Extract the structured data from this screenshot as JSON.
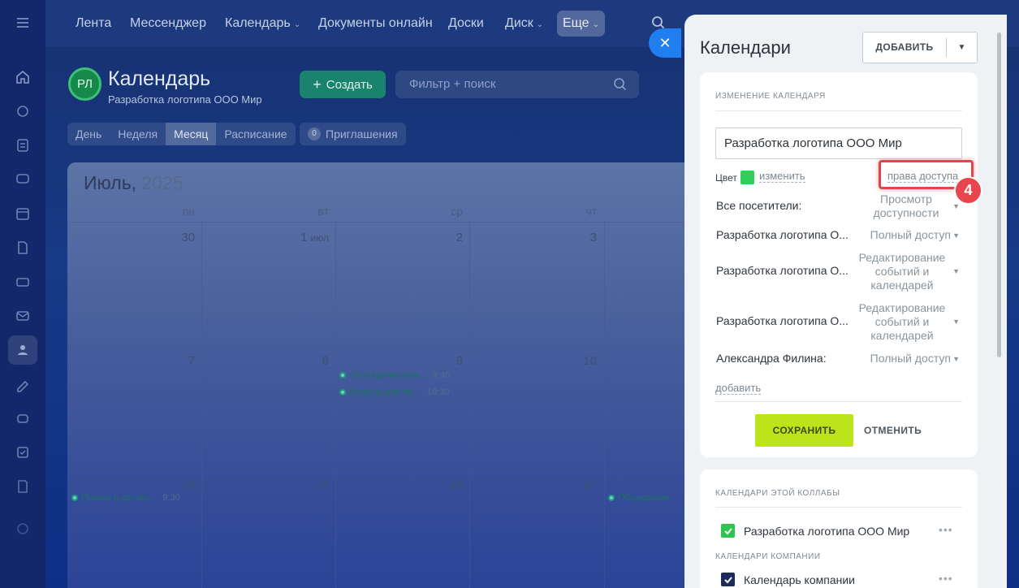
{
  "topnav": {
    "items": [
      "Лента",
      "Мессенджер",
      "Календарь",
      "Документы онлайн",
      "Доски",
      "Диск",
      "Еще"
    ]
  },
  "calendar": {
    "logo": "РЛ",
    "title": "Календарь",
    "subtitle": "Разработка логотипа ООО Мир",
    "create_label": "Создать",
    "filter_placeholder": "Фильтр + поиск",
    "views": [
      "День",
      "Неделя",
      "Месяц",
      "Расписание"
    ],
    "active_view": "Месяц",
    "invites_count": "0",
    "invites_label": "Приглашения",
    "month": "Июль,",
    "year": "2025",
    "weekdays": [
      "пн",
      "вт",
      "ср",
      "чт"
    ],
    "week1": [
      "30",
      "1",
      "2",
      "3"
    ],
    "week1_month": "июл",
    "week2": [
      "7",
      "8",
      "9",
      "10"
    ],
    "week3": [
      "14",
      "15",
      "16",
      "17"
    ],
    "events": [
      {
        "title": "Обсуждение мак...",
        "time": "9:40"
      },
      {
        "title": "Встреча для по...",
        "time": "10:30"
      },
      {
        "title": "Правки в догово...",
        "time": "9:30"
      },
      {
        "title": "Обсуждение",
        "time": ""
      }
    ]
  },
  "panel": {
    "title": "Календари",
    "add_label": "ДОБАВИТЬ",
    "edit_section": "ИЗМЕНЕНИЕ КАЛЕНДАРЯ",
    "name_value": "Разработка логотипа ООО Мир",
    "color_label": "Цвет",
    "color_value": "#2fd05a",
    "change_link": "изменить",
    "access_link": "права доступа",
    "step_badge": "4",
    "permissions": [
      {
        "name": "Все посетители:",
        "value": "Просмотр доступности"
      },
      {
        "name": "Разработка логотипа О...",
        "value": "Полный доступ"
      },
      {
        "name": "Разработка логотипа О...",
        "value": "Редактирование событий и календарей"
      },
      {
        "name": "Разработка логотипа О...",
        "value": "Редактирование событий и календарей"
      },
      {
        "name": "Александра Филина:",
        "value": "Полный доступ"
      }
    ],
    "add_link": "добавить",
    "save_label": "СОХРАНИТЬ",
    "cancel_label": "ОТМЕНИТЬ",
    "collab_section": "КАЛЕНДАРИ ЭТОЙ КОЛЛАБЫ",
    "collab_calendar": "Разработка логотипа ООО Мир",
    "company_section": "КАЛЕНДАРИ КОМПАНИИ",
    "company_calendar": "Календарь компании"
  }
}
